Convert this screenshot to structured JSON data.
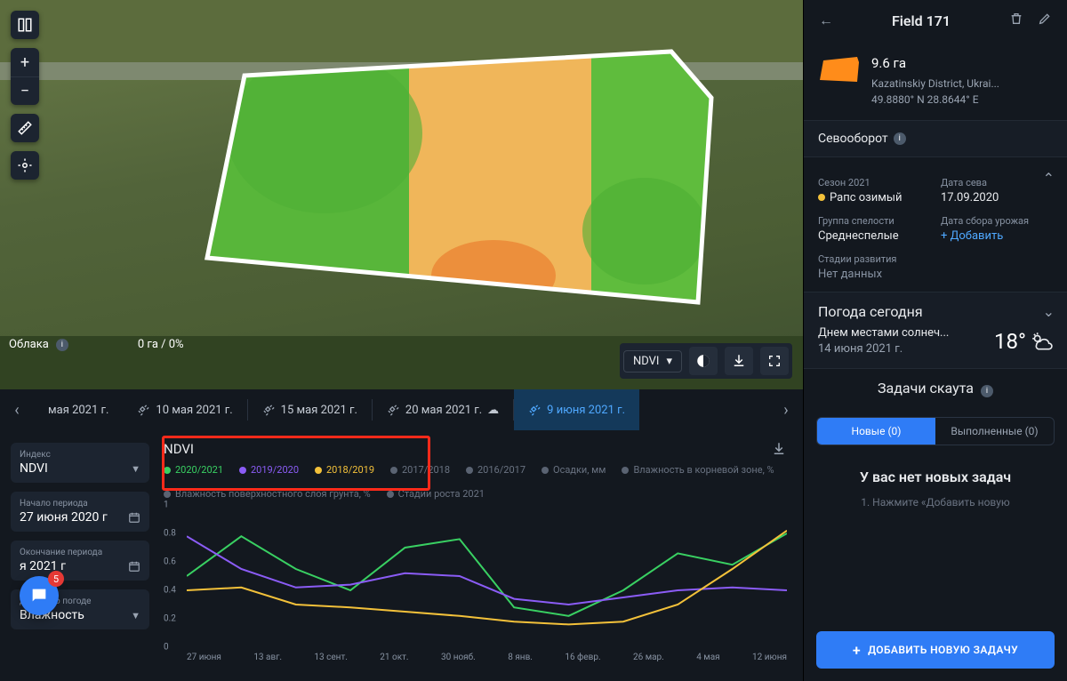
{
  "map": {
    "clouds_label": "Облака",
    "clouds_value": "0 га / 0%",
    "layer": "NDVI"
  },
  "dates": {
    "items": [
      {
        "label": "мая 2021 г.",
        "partial": true
      },
      {
        "label": "10 мая 2021 г."
      },
      {
        "label": "15 мая 2021 г."
      },
      {
        "label": "20 мая 2021 г.",
        "trailing_icon": "cloud"
      },
      {
        "label": "9 июня 2021 г.",
        "active": true
      }
    ]
  },
  "controls": {
    "index": {
      "label": "Индекс",
      "value": "NDVI"
    },
    "period_start": {
      "label": "Начало периода",
      "value": "27 июня 2020 г"
    },
    "period_end": {
      "label": "Окончание периода",
      "value": "я 2021 г"
    },
    "weather_data": {
      "label": "Данные о погоде",
      "value": "Влажность"
    }
  },
  "chat_badge": "5",
  "chart": {
    "title": "NDVI",
    "legend_active": [
      {
        "label": "2020/2021",
        "color": "#39d062"
      },
      {
        "label": "2019/2020",
        "color": "#8b5cf6"
      },
      {
        "label": "2018/2019",
        "color": "#f3c13a"
      }
    ],
    "legend_dim": [
      "2017/2018",
      "2016/2017",
      "Осадки, мм",
      "Влажность в корневой зоне, %",
      "Влажность поверхностного слоя грунта, %",
      "Стадии роста 2021"
    ]
  },
  "chart_data": {
    "type": "line",
    "title": "NDVI",
    "ylabel": "",
    "ylim": [
      0,
      1
    ],
    "y_ticks": [
      0,
      0.2,
      0.4,
      0.6,
      0.8,
      1
    ],
    "categories": [
      "27 июня",
      "13 авг.",
      "13 сент.",
      "21 окт.",
      "30 нояб.",
      "8 янв.",
      "16 февр.",
      "26 мар.",
      "4 мая",
      "12 июня"
    ],
    "series": [
      {
        "name": "2020/2021",
        "color": "#39d062",
        "values": [
          0.5,
          0.78,
          0.55,
          0.4,
          0.7,
          0.76,
          0.28,
          0.22,
          0.4,
          0.66,
          0.58,
          0.8
        ]
      },
      {
        "name": "2019/2020",
        "color": "#8b5cf6",
        "values": [
          0.78,
          0.55,
          0.42,
          0.44,
          0.52,
          0.5,
          0.34,
          0.3,
          0.35,
          0.4,
          0.42,
          0.4
        ]
      },
      {
        "name": "2018/2019",
        "color": "#f3c13a",
        "values": [
          0.4,
          0.42,
          0.3,
          0.28,
          0.25,
          0.22,
          0.18,
          0.16,
          0.18,
          0.3,
          0.55,
          0.82
        ]
      }
    ]
  },
  "field": {
    "title": "Field 171",
    "area": "9.6 га",
    "district": "Kazatinskiy District, Ukrai...",
    "coords": "49.8880° N 28.8644° E"
  },
  "rotation": {
    "heading": "Севооборот",
    "season_label": "Сезон 2021",
    "season_value": "Рапс озимый",
    "sowing_label": "Дата сева",
    "sowing_value": "17.09.2020",
    "maturity_label": "Группа спелости",
    "maturity_value": "Среднеспелые",
    "harvest_label": "Дата сбора урожая",
    "harvest_add": "+ Добавить",
    "stage_label": "Стадии развития",
    "stage_value": "Нет данных"
  },
  "weather": {
    "heading": "Погода сегодня",
    "desc": "Днем местами солнеч...",
    "date": "14 июня 2021 г.",
    "temp": "18°"
  },
  "scout": {
    "heading": "Задачи скаута",
    "tab_new": "Новые (0)",
    "tab_done": "Выполненные (0)",
    "empty_title": "У вас нет новых задач",
    "empty_hint": "1.  Нажмите «Добавить новую",
    "add_btn": "ДОБАВИТЬ НОВУЮ ЗАДАЧУ"
  }
}
